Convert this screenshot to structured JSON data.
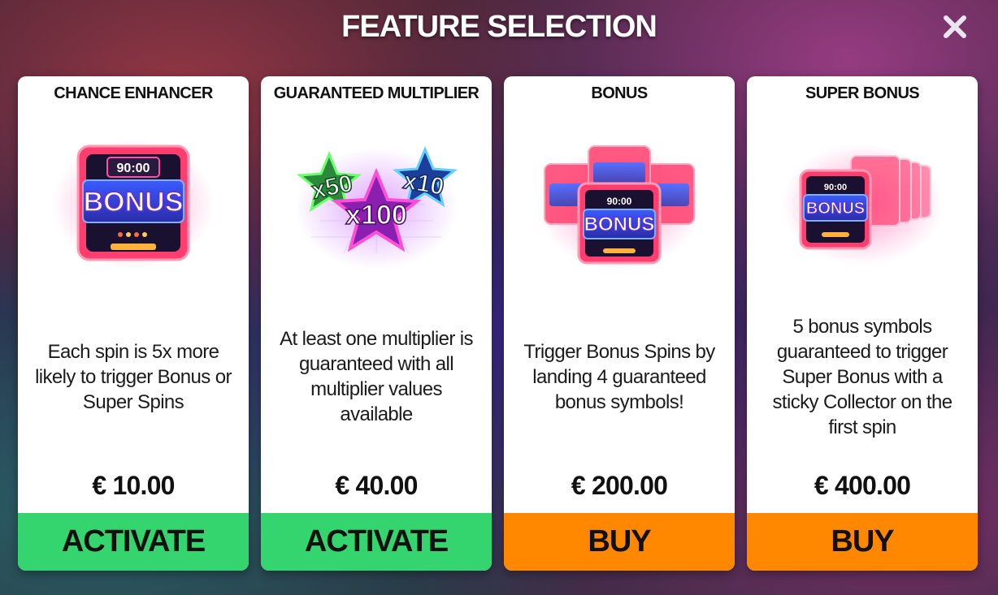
{
  "header": {
    "title": "FEATURE SELECTION",
    "close_icon": "close-icon"
  },
  "colors": {
    "activate": "#34d46e",
    "buy": "#ff8800",
    "card_bg": "#ffffff",
    "neon_pink": "#ff2d7a",
    "neon_blue": "#4a7dff"
  },
  "cards": [
    {
      "title": "CHANCE ENHANCER",
      "art": "bonus-sign-icon",
      "art_timer": "90:00",
      "art_label": "BONUS",
      "description": "Each spin is 5x more likely to trigger Bonus or Super Spins",
      "price": "€ 10.00",
      "button": "ACTIVATE"
    },
    {
      "title": "GUARANTEED MULTIPLIER",
      "art": "multiplier-stars-icon",
      "art_values": [
        "x50",
        "x10",
        "x100"
      ],
      "description": "At least one multiplier is guaranteed with all multiplier values available",
      "price": "€ 40.00",
      "button": "ACTIVATE"
    },
    {
      "title": "BONUS",
      "art": "bonus-signs-stack-icon",
      "art_timer": "90:00",
      "art_label": "BONUS",
      "description": "Trigger Bonus Spins by landing 4 guaranteed bonus symbols!",
      "price": "€ 200.00",
      "button": "BUY"
    },
    {
      "title": "SUPER BONUS",
      "art": "bonus-signs-row-icon",
      "art_timer": "90:00",
      "art_label": "BONUS",
      "description": "5 bonus symbols guaranteed to trigger Super Bonus with a sticky Collector on the first spin",
      "price": "€ 400.00",
      "button": "BUY"
    }
  ]
}
